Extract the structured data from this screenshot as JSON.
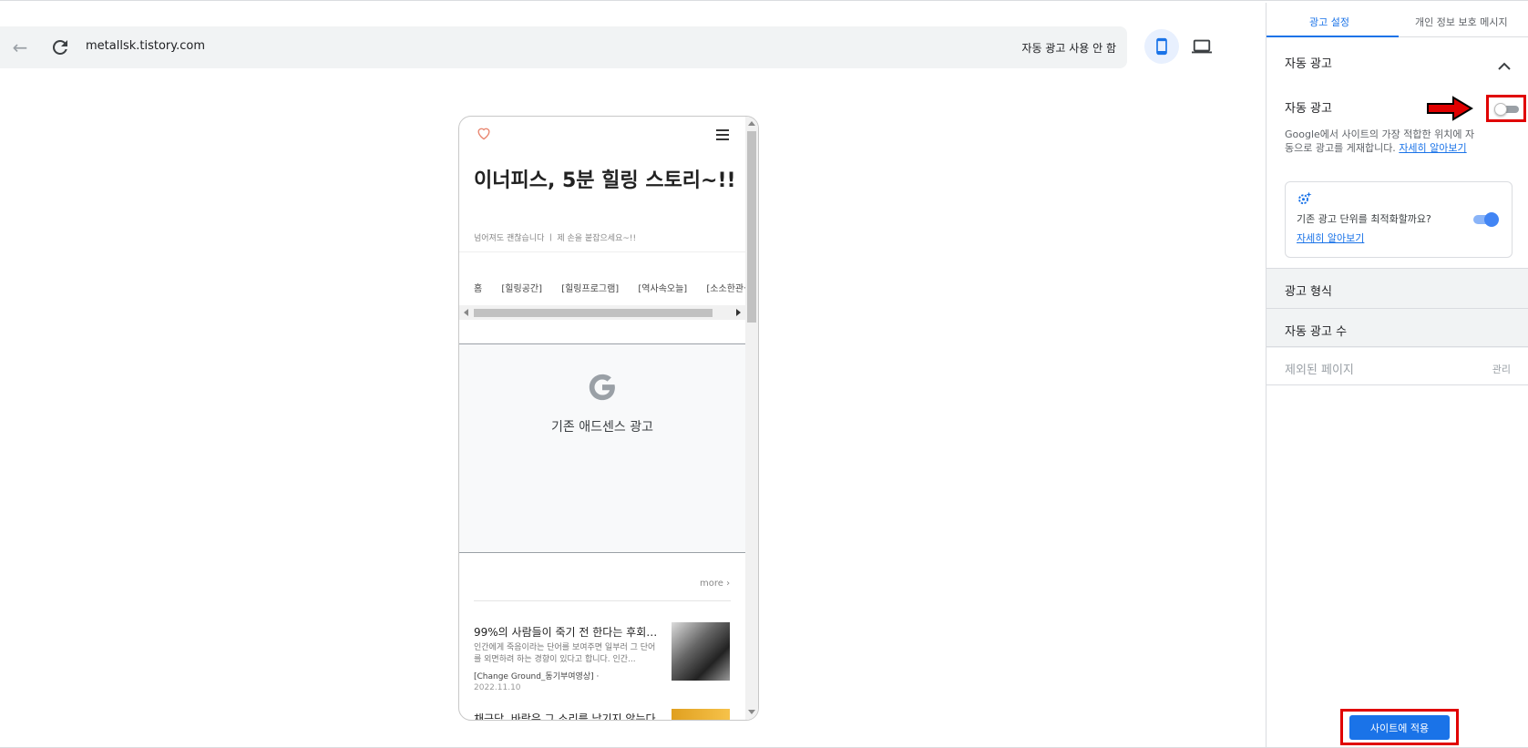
{
  "urlbar": {
    "url": "metallsk.tistory.com",
    "auto_ads_status": "자동 광고 사용 안 함"
  },
  "phone": {
    "blog_title": "이너피스, 5분 힐링 스토리~!!",
    "blog_subtitle": "넘어져도 괜찮습니다 ㅣ 제 손을 붙잡으세요~!!",
    "nav_items": [
      "홈",
      "[힐링공간]",
      "[힐링프로그램]",
      "[역사속오늘]",
      "[소소한관심]"
    ],
    "ad_label": "기존 애드센스 광고",
    "more_label": "more ›",
    "posts": [
      {
        "title": "99%의 사람들이 죽기 전 한다는 후회, ...",
        "excerpt": "인간에게 죽음이라는 단어를 보여주면 일부러 그 단어를 외면하려 하는 경향이 있다고 합니다. 인간...",
        "category": "[Change Ground_동기부여영상] ·",
        "date": "2022.11.10"
      },
      {
        "title": "채근담, 바람은 그 소리를 남기지 않는다"
      }
    ]
  },
  "panel": {
    "tabs": [
      "광고 설정",
      "개인 정보 보호 메시지"
    ],
    "auto_ads_section": "자동 광고",
    "auto_ads_toggle_label": "자동 광고",
    "description": "Google에서 사이트의 가장 적합한 위치에 자동으로 광고를 게재합니다.",
    "learn_more": "자세히 알아보기",
    "optimize_label": "기존 광고 단위를 최적화할까요?",
    "optimize_link": "자세히 알아보기",
    "ad_format": "광고 형식",
    "ad_count": "자동 광고 수",
    "excluded_pages": "제외된 페이지",
    "manage": "관리",
    "apply_button": "사이트에 적용"
  },
  "colors": {
    "accent": "#1a73e8",
    "highlight": "#e00000"
  }
}
